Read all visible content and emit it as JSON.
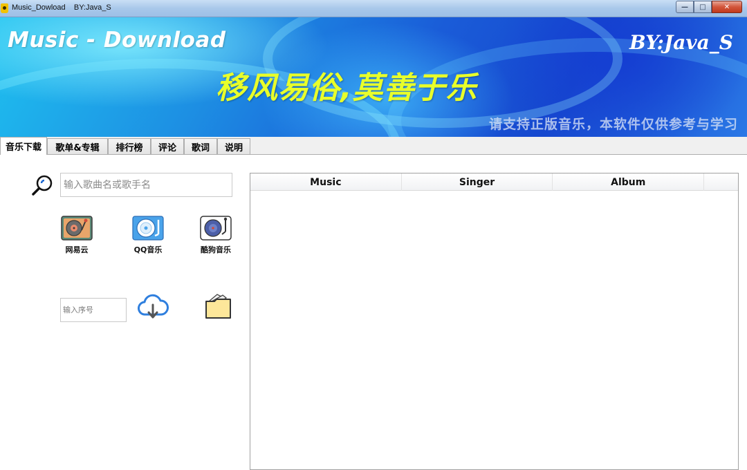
{
  "window": {
    "title": "Music_Dowload    BY:Java_S",
    "minimize_glyph": "—",
    "maximize_glyph": "□",
    "close_glyph": "✕"
  },
  "banner": {
    "title": "Music - Download",
    "by": "BY:Java_S",
    "slogan": "移风易俗,莫善于乐",
    "notice": "请支持正版音乐，本软件仅供参考与学习"
  },
  "tabs": [
    {
      "label": "音乐下载",
      "active": true
    },
    {
      "label": "歌单&专辑",
      "active": false
    },
    {
      "label": "排行榜",
      "active": false
    },
    {
      "label": "评论",
      "active": false
    },
    {
      "label": "歌词",
      "active": false
    },
    {
      "label": "说明",
      "active": false
    }
  ],
  "search": {
    "placeholder": "输入歌曲名或歌手名",
    "value": ""
  },
  "sources": [
    {
      "label": "网易云",
      "icon": "turntable-icon"
    },
    {
      "label": "QQ音乐",
      "icon": "cd-player-icon"
    },
    {
      "label": "酷狗音乐",
      "icon": "record-player-icon"
    }
  ],
  "download": {
    "index_placeholder": "输入序号",
    "index_value": "",
    "download_icon": "cloud-download-icon",
    "folder_icon": "folder-icon"
  },
  "table": {
    "columns": [
      "Music",
      "Singer",
      "Album"
    ],
    "rows": []
  },
  "colors": {
    "accent_yellow": "#e8ff2a",
    "banner_blue": "#1a5cd8",
    "close_red": "#c2391c"
  }
}
